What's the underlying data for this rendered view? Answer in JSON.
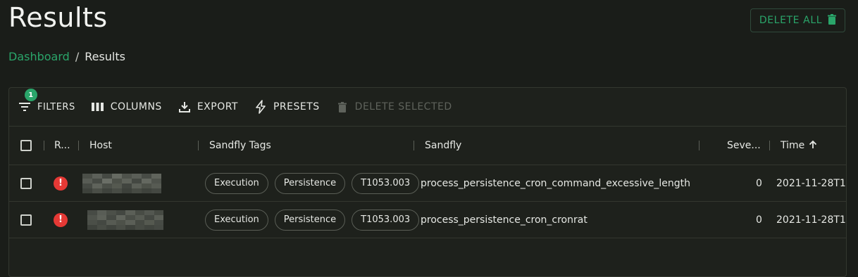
{
  "page": {
    "title": "Results",
    "delete_all_label": "DELETE ALL"
  },
  "breadcrumb": {
    "link": "Dashboard",
    "separator": "/",
    "current": "Results"
  },
  "toolbar": {
    "filters_label": "FILTERS",
    "filters_count": "1",
    "columns_label": "COLUMNS",
    "export_label": "EXPORT",
    "presets_label": "PRESETS",
    "delete_selected_label": "DELETE SELECTED"
  },
  "columns": {
    "risk": "R...",
    "host": "Host",
    "tags": "Sandfly Tags",
    "sandfly": "Sandfly",
    "severity": "Seve...",
    "time": "Time"
  },
  "rows": [
    {
      "risk_icon": "error-icon",
      "host": "",
      "tags": [
        "Execution",
        "Persistence",
        "T1053.003"
      ],
      "sandfly": "process_persistence_cron_command_excessive_length",
      "severity": "0",
      "time": "2021-11-28T1"
    },
    {
      "risk_icon": "error-icon",
      "host": "",
      "tags": [
        "Execution",
        "Persistence",
        "T1053.003"
      ],
      "sandfly": "process_persistence_cron_cronrat",
      "severity": "0",
      "time": "2021-11-28T1"
    }
  ],
  "colors": {
    "accent": "#2aa56a",
    "background": "#1a1d19",
    "risk_high": "#e53935"
  }
}
